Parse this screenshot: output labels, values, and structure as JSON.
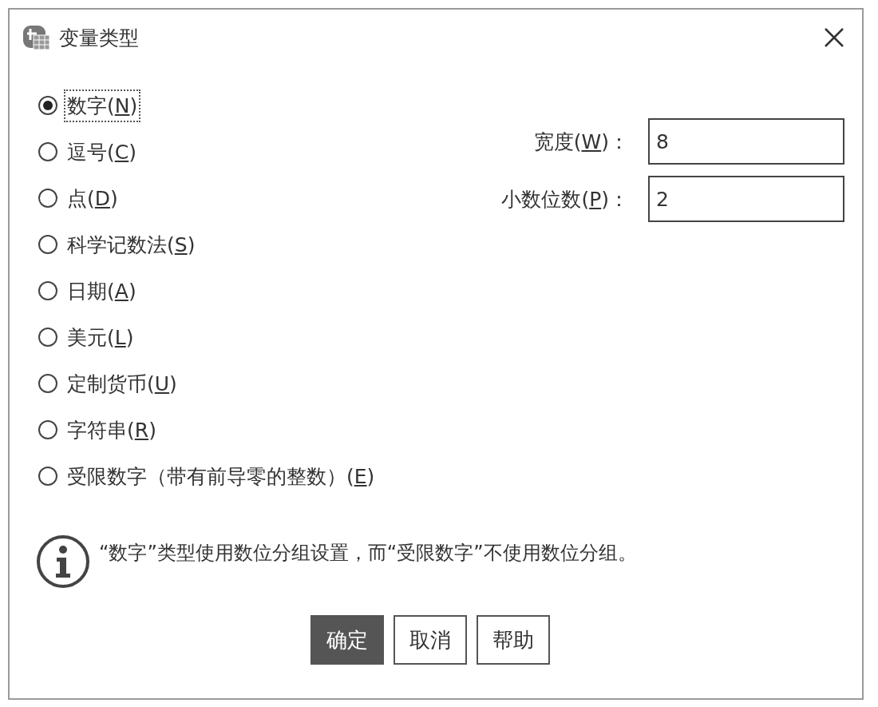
{
  "window": {
    "title": "变量类型"
  },
  "types": [
    {
      "before": "数字(",
      "mnemonic": "N",
      "after": ")",
      "selected": true,
      "focused": true
    },
    {
      "before": "逗号(",
      "mnemonic": "C",
      "after": ")",
      "selected": false,
      "focused": false
    },
    {
      "before": "点(",
      "mnemonic": "D",
      "after": ")",
      "selected": false,
      "focused": false
    },
    {
      "before": "科学记数法(",
      "mnemonic": "S",
      "after": ")",
      "selected": false,
      "focused": false
    },
    {
      "before": "日期(",
      "mnemonic": "A",
      "after": ")",
      "selected": false,
      "focused": false
    },
    {
      "before": "美元(",
      "mnemonic": "L",
      "after": ")",
      "selected": false,
      "focused": false
    },
    {
      "before": "定制货币(",
      "mnemonic": "U",
      "after": ")",
      "selected": false,
      "focused": false
    },
    {
      "before": "字符串(",
      "mnemonic": "R",
      "after": ")",
      "selected": false,
      "focused": false
    },
    {
      "before": "受限数字（带有前导零的整数）(",
      "mnemonic": "E",
      "after": ")",
      "selected": false,
      "focused": false
    }
  ],
  "fields": [
    {
      "before": "宽度(",
      "mnemonic": "W",
      "after": ")：",
      "value": "8"
    },
    {
      "before": "小数位数(",
      "mnemonic": "P",
      "after": ")：",
      "value": "2"
    }
  ],
  "info": "“数字”类型使用数位分组设置，而“受限数字”不使用数位分组。",
  "buttons": [
    {
      "label": "确定",
      "primary": true
    },
    {
      "label": "取消",
      "primary": false
    },
    {
      "label": "帮助",
      "primary": false
    }
  ]
}
